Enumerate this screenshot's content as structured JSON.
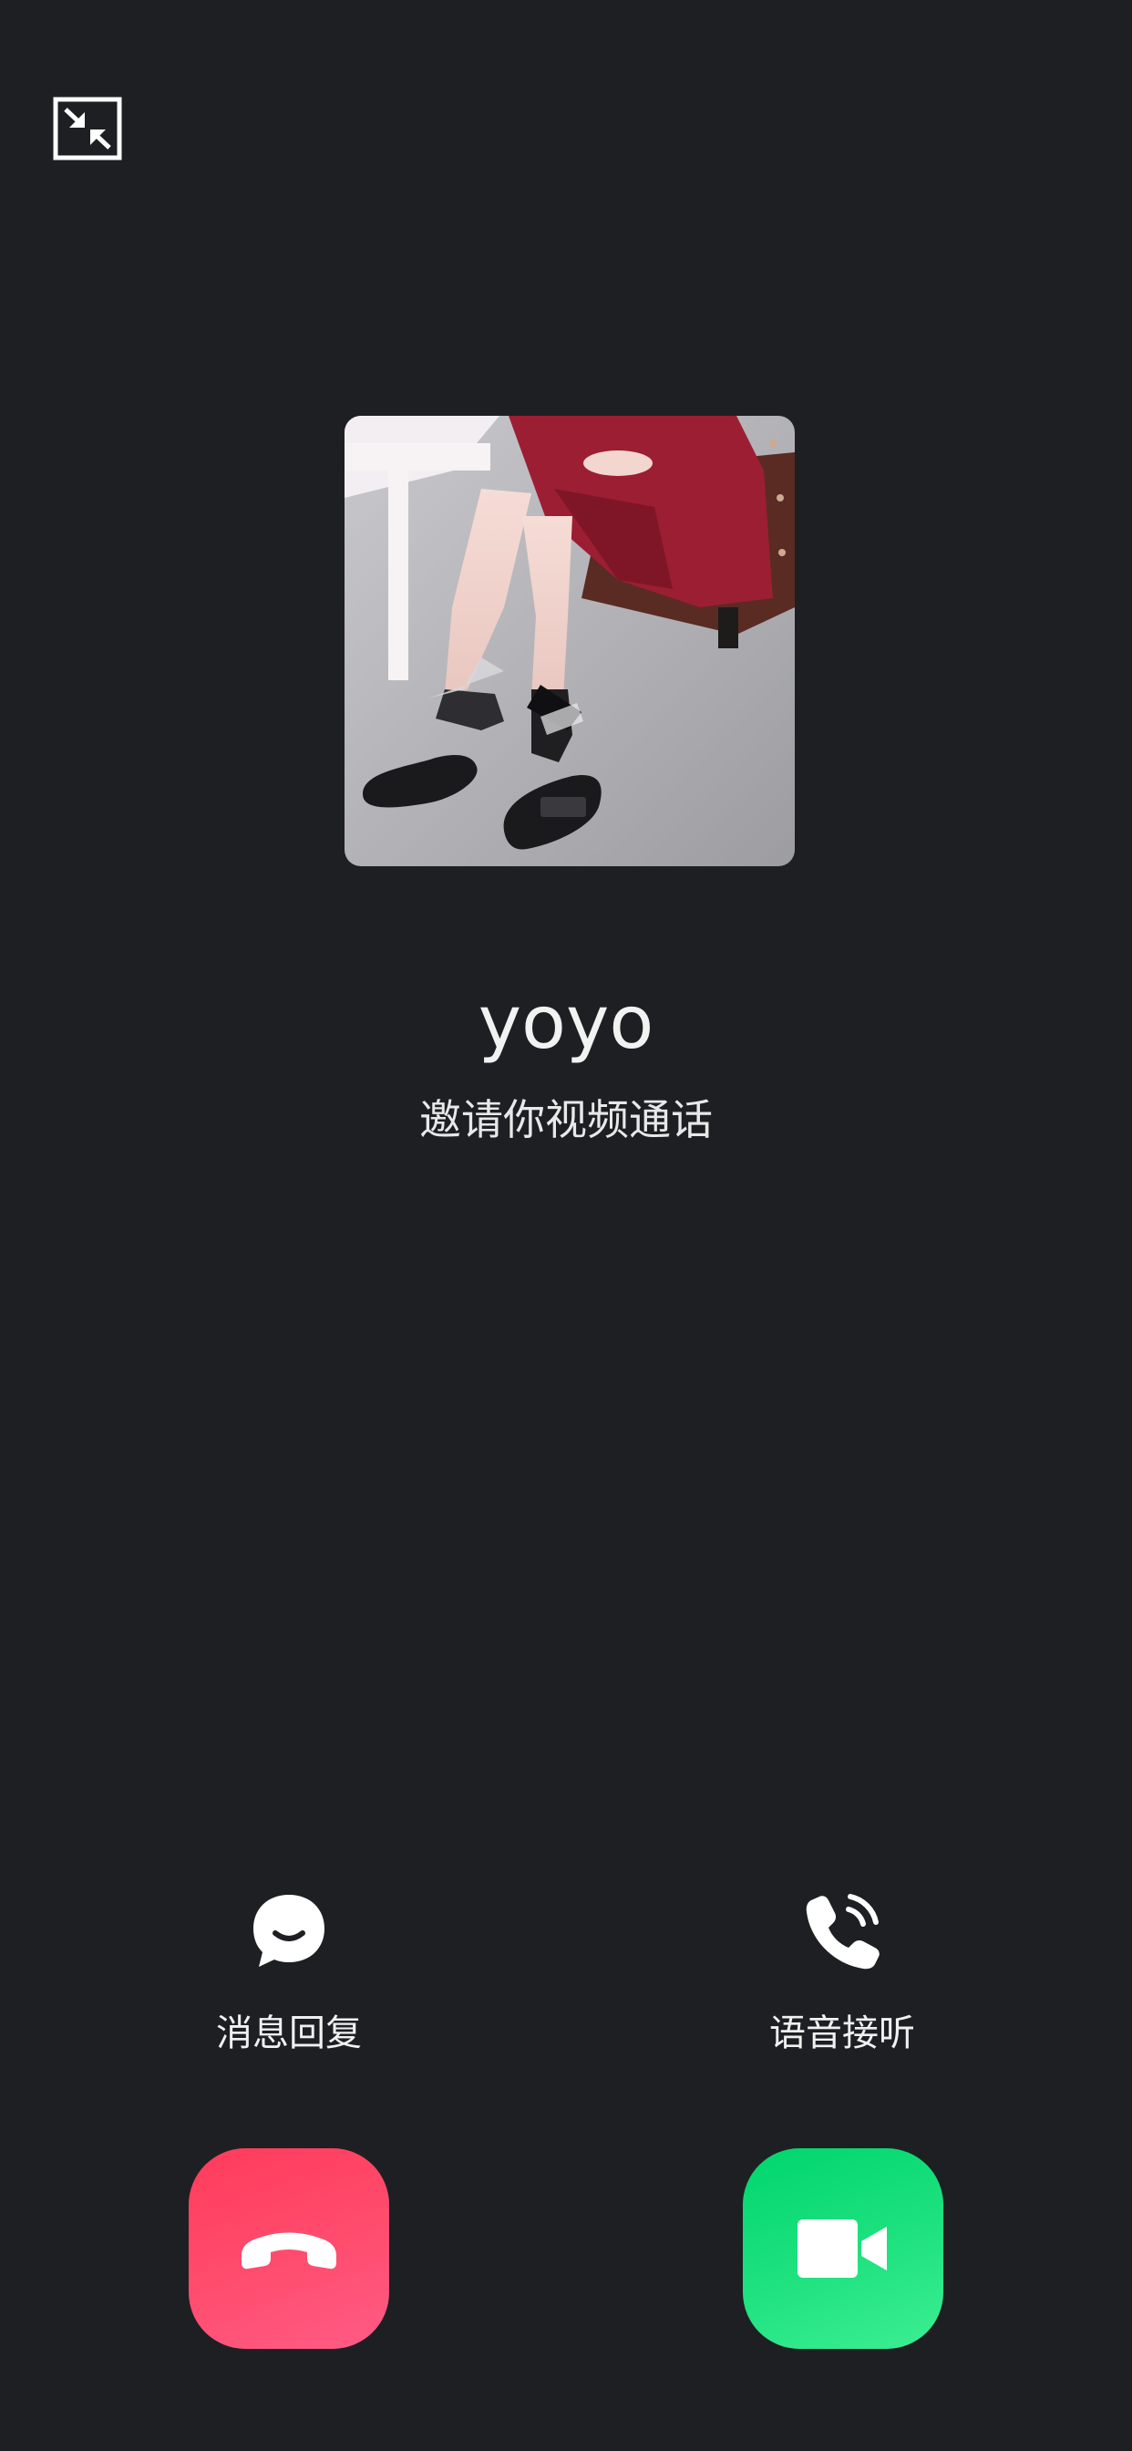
{
  "call": {
    "caller_name": "yoyo",
    "subtitle": "邀请你视频通话"
  },
  "quick_actions": {
    "message_reply_label": "消息回复",
    "voice_answer_label": "语音接听"
  },
  "icons": {
    "minimize": "minimize-icon",
    "message": "chat-bubble-icon",
    "voice": "phone-call-icon",
    "decline": "hang-up-icon",
    "accept": "video-camera-icon"
  },
  "colors": {
    "background": "#1e1f23",
    "decline": "#ff4d6e",
    "accept": "#1fe27f",
    "text": "#ffffff"
  }
}
